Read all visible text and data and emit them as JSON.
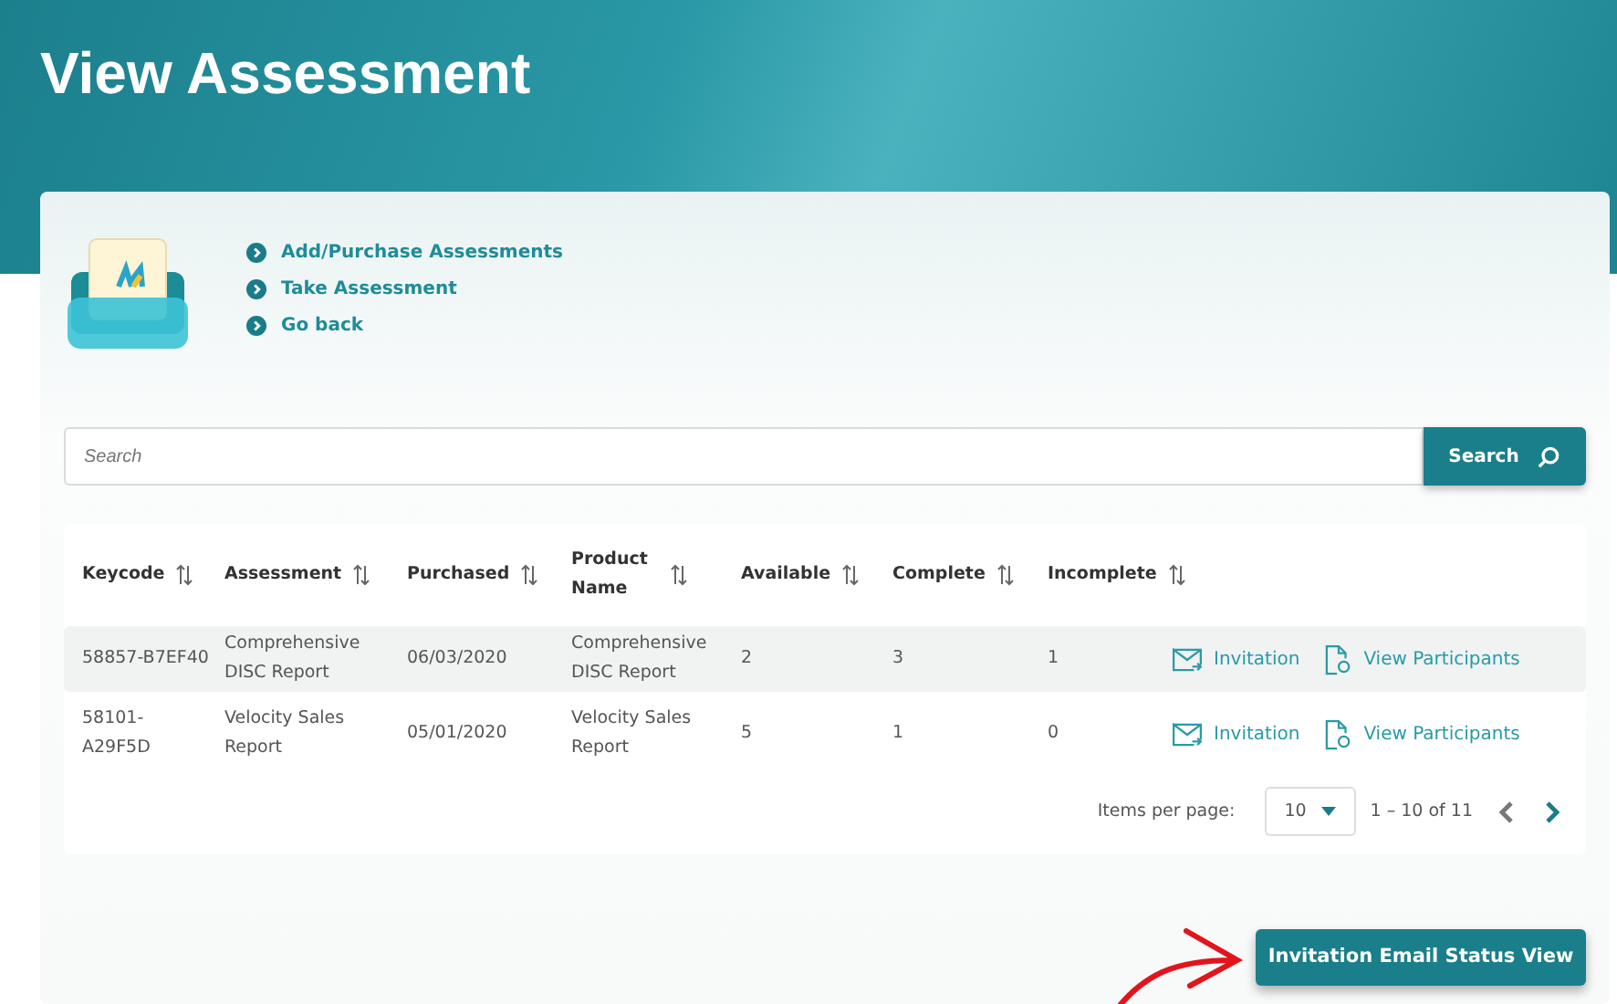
{
  "page": {
    "title": "View Assessment"
  },
  "links": [
    "Add/Purchase Assessments",
    "Take Assessment",
    "Go back"
  ],
  "search": {
    "placeholder": "Search",
    "button": "Search"
  },
  "table": {
    "columns": [
      "Keycode",
      "Assessment",
      "Purchased",
      "Product Name",
      "Available",
      "Complete",
      "Incomplete"
    ],
    "rows": [
      {
        "selected": true,
        "cells": [
          "58857-B7EF40",
          "Comprehensive DISC Report",
          "06/03/2020",
          "Comprehensive DISC Report",
          "2",
          "3",
          "1"
        ],
        "actions": [
          "Invitation",
          "View Participants"
        ]
      },
      {
        "selected": false,
        "cells": [
          "58101-A29F5D",
          "Velocity Sales Report",
          "05/01/2020",
          "Velocity Sales Report",
          "5",
          "1",
          "0"
        ],
        "actions": [
          "Invitation",
          "View Participants"
        ]
      }
    ]
  },
  "pagination": {
    "label": "Items per page:",
    "page_size": "10",
    "range": "1 – 10 of 11",
    "prev_disabled": true,
    "next_disabled": false
  },
  "primary_button": "Invitation Email Status View"
}
